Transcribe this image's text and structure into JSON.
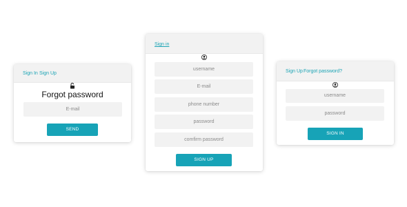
{
  "forgot": {
    "tabs": [
      "Sign In",
      "Sign Up"
    ],
    "title": "Forgot password",
    "email_placeholder": "E-mail",
    "button": "SEND",
    "icon": "unlock-icon"
  },
  "signup": {
    "tab": "Sign in",
    "fields": [
      "username",
      "E-mail",
      "phone number",
      "password",
      "comfirm password"
    ],
    "button": "SIGN UP",
    "icon": "user-icon"
  },
  "signin": {
    "tabs": [
      "Sign Up",
      "Forgot password?"
    ],
    "fields": [
      "username",
      "password"
    ],
    "button": "SIGN IN",
    "icon": "user-icon"
  },
  "colors": {
    "accent": "#17a3b7",
    "link": "#1aa3b4",
    "field_bg": "#f2f2f2"
  }
}
